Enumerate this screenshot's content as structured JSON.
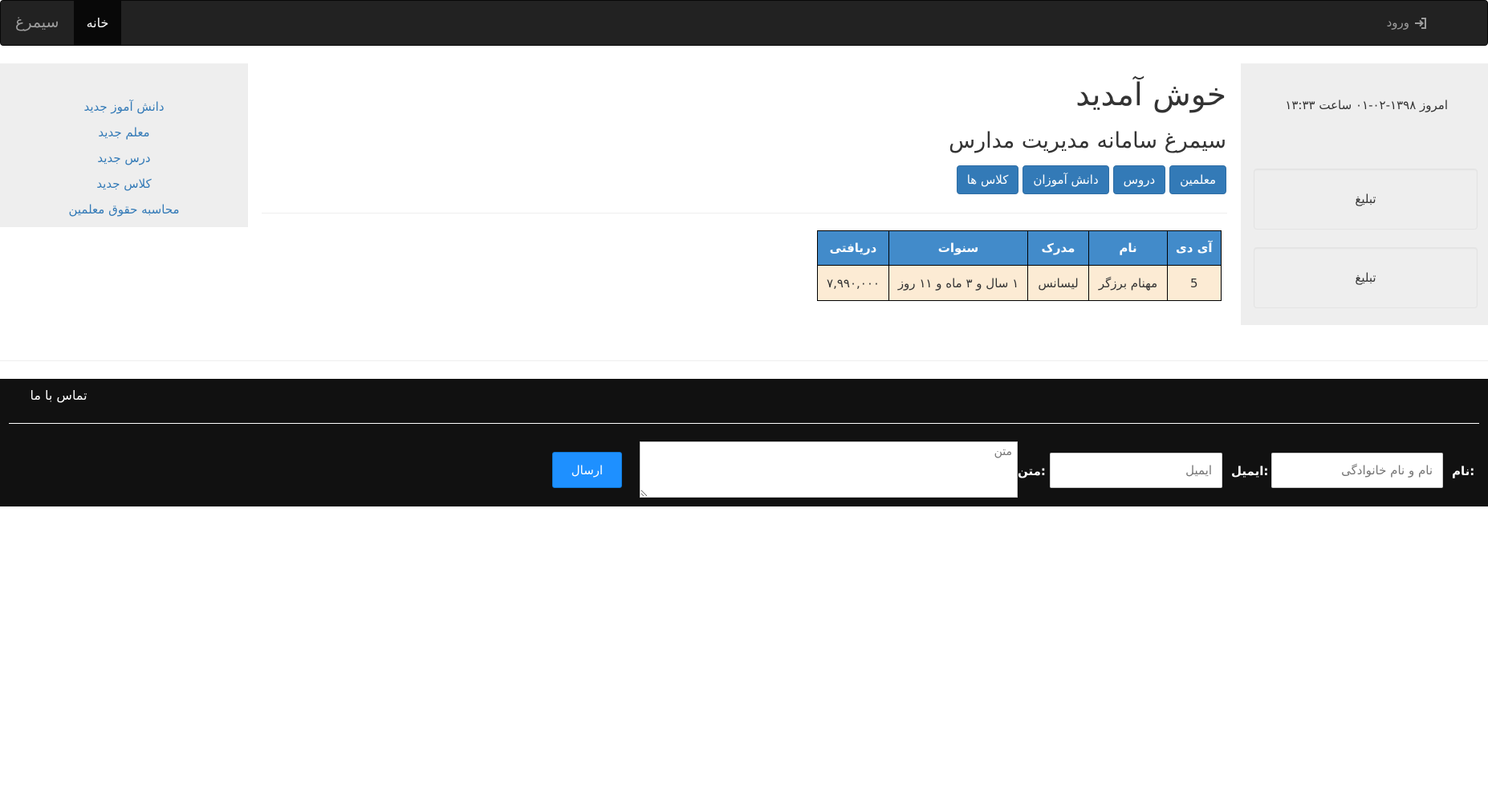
{
  "navbar": {
    "brand": "سیمرغ",
    "home": "خانه",
    "login": "ورود"
  },
  "sidebar_left": {
    "links": [
      "دانش آموز جدید",
      "معلم جدید",
      "درس جدید",
      "کلاس جدید",
      "محاسبه حقوق معلمین"
    ]
  },
  "sidebar_right": {
    "today": "امروز ۱۳۹۸-۰۲-۰۱ ساعت ۱۳:۳۳",
    "ads": [
      "تبلیغ",
      "تبلیغ"
    ]
  },
  "main": {
    "title": "خوش آمدید",
    "subtitle": "سیمرغ سامانه مدیریت مدارس",
    "buttons": [
      "معلمین",
      "دروس",
      "دانش آموزان",
      "کلاس ها"
    ]
  },
  "table": {
    "headers": [
      "آی دی",
      "نام",
      "مدرک",
      "سنوات",
      "دریافتی"
    ],
    "rows": [
      [
        "5",
        "مهنام برزگر",
        "لیسانس",
        "۱ سال و ۳ ماه و ۱۱ روز",
        "۷,۹۹۰,۰۰۰"
      ]
    ]
  },
  "footer": {
    "title": "تماس با ما",
    "name_label": "نام:",
    "name_placeholder": "نام و نام خانوادگی",
    "email_label": "ایمیل:",
    "email_placeholder": "ایمیل",
    "text_label": "متن:",
    "text_placeholder": "متن",
    "send": "ارسال"
  },
  "colors": {
    "navbar_bg": "#222222",
    "primary": "#337ab7",
    "table_header": "#428bca",
    "table_cell": "#fcebd4",
    "footer_bg": "#111111",
    "send_button": "#1e90ff"
  }
}
